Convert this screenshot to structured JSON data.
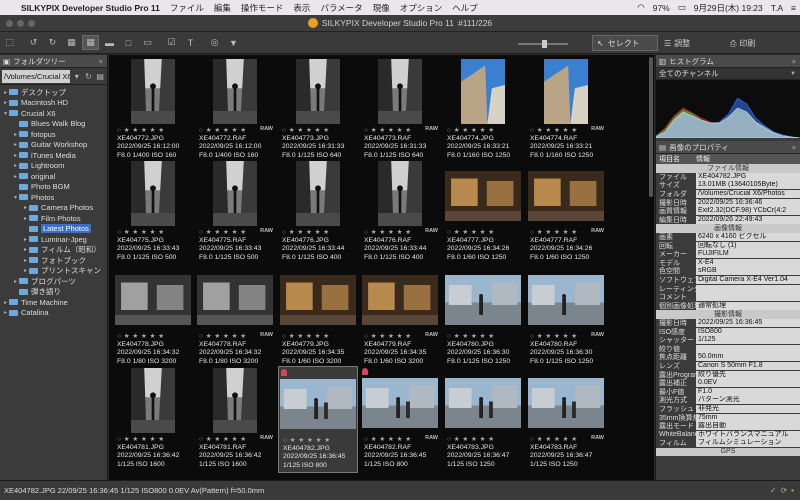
{
  "menubar": {
    "app_name": "SILKYPIX Developer Studio Pro 11",
    "menus": [
      "ファイル",
      "編集",
      "操作モード",
      "表示",
      "パラメータ",
      "現像",
      "オプション",
      "ヘルプ"
    ],
    "battery": "97%",
    "datetime": "9月29日(木) 19:23",
    "user": "T.A"
  },
  "titlebar": {
    "title": "SILKYPIX Developer Studio Pro 11",
    "counter": "#111/226"
  },
  "toolbar": {
    "mode_select": "セレクト",
    "adjust_label": "調整",
    "print_label": "印刷"
  },
  "folder_tree": {
    "header": "フォルダツリー",
    "path": "/Volumes/Crucial X6/",
    "items": [
      {
        "label": "デスクトップ",
        "level": 0,
        "arrow": "▸"
      },
      {
        "label": "Macintosh HD",
        "level": 0,
        "arrow": "▸"
      },
      {
        "label": "Crucial X6",
        "level": 0,
        "arrow": "▾"
      },
      {
        "label": "Blues Walk Blog",
        "level": 1,
        "arrow": ""
      },
      {
        "label": "fotopus",
        "level": 1,
        "arrow": "▸"
      },
      {
        "label": "Guitar Workshop",
        "level": 1,
        "arrow": "▸"
      },
      {
        "label": "iTunes Media",
        "level": 1,
        "arrow": "▸"
      },
      {
        "label": "Lightroom",
        "level": 1,
        "arrow": "▸"
      },
      {
        "label": "original",
        "level": 1,
        "arrow": "▸"
      },
      {
        "label": "Photo BGM",
        "level": 1,
        "arrow": ""
      },
      {
        "label": "Photos",
        "level": 1,
        "arrow": "▾"
      },
      {
        "label": "Camera Photos",
        "level": 2,
        "arrow": "▸"
      },
      {
        "label": "Film Photos",
        "level": 2,
        "arrow": "▸"
      },
      {
        "label": "Latest Photos",
        "level": 2,
        "arrow": "",
        "selected": true
      },
      {
        "label": "Luminar-Jpeg",
        "level": 2,
        "arrow": "▸"
      },
      {
        "label": "フィルム（昭和）",
        "level": 2,
        "arrow": "▸"
      },
      {
        "label": "フォトブック",
        "level": 2,
        "arrow": "▸"
      },
      {
        "label": "プリントスキャン",
        "level": 2,
        "arrow": "▸"
      },
      {
        "label": "ブログパーツ",
        "level": 1,
        "arrow": "▸"
      },
      {
        "label": "弾き語り",
        "level": 1,
        "arrow": ""
      },
      {
        "label": "Time Machine",
        "level": 0,
        "arrow": "▸"
      },
      {
        "label": "Catalina",
        "level": 0,
        "arrow": "▸"
      }
    ]
  },
  "thumbnails": [
    {
      "name": "XE404772.JPG",
      "date": "2022/09/25 16:12:00",
      "exif": "F8.0 1/400 ISO 160",
      "raw": false,
      "img": "bwstreet"
    },
    {
      "name": "XE404772.RAF",
      "date": "2022/09/25 16:12:00",
      "exif": "F8.0 1/400 ISO 160",
      "raw": true,
      "img": "bwstreet"
    },
    {
      "name": "XE404773.JPG",
      "date": "2022/09/25 16:31:33",
      "exif": "F8.0 1/125 ISO 640",
      "raw": false,
      "img": "bwalley"
    },
    {
      "name": "XE404773.RAF",
      "date": "2022/09/25 16:31:33",
      "exif": "F8.0 1/125 ISO 640",
      "raw": true,
      "img": "bwalley"
    },
    {
      "name": "XE404774.JPG",
      "date": "2022/09/25 16:33:21",
      "exif": "F8.0 1/160 ISO 1250",
      "raw": false,
      "img": "sky"
    },
    {
      "name": "XE404774.RAF",
      "date": "2022/09/25 16:33:21",
      "exif": "F8.0 1/160 ISO 1250",
      "raw": true,
      "img": "sky"
    },
    {
      "name": "XE404775.JPG",
      "date": "2022/09/25 16:33:43",
      "exif": "F8.0 1/125 ISO 500",
      "raw": false,
      "img": "bwperson"
    },
    {
      "name": "XE404775.RAF",
      "date": "2022/09/25 16:33:43",
      "exif": "F8.0 1/125 ISO 500",
      "raw": true,
      "img": "bwperson"
    },
    {
      "name": "XE404776.JPG",
      "date": "2022/09/25 16:33:44",
      "exif": "F8.0 1/125 ISO 400",
      "raw": false,
      "img": "bwperson2"
    },
    {
      "name": "XE404776.RAF",
      "date": "2022/09/25 16:33:44",
      "exif": "F8.0 1/125 ISO 400",
      "raw": true,
      "img": "bwperson2"
    },
    {
      "name": "XE404777.JPG",
      "date": "2022/09/25 16:34:26",
      "exif": "F8.0 1/60 ISO 1250",
      "raw": false,
      "img": "shop"
    },
    {
      "name": "XE404777.RAF",
      "date": "2022/09/25 16:34:26",
      "exif": "F8.0 1/60 ISO 1250",
      "raw": true,
      "img": "shop"
    },
    {
      "name": "XE404778.JPG",
      "date": "2022/09/25 16:34:32",
      "exif": "F8.0 1/80 ISO 3200",
      "raw": false,
      "img": "bwshop"
    },
    {
      "name": "XE404778.RAF",
      "date": "2022/09/25 16:34:32",
      "exif": "F8.0 1/80 ISO 3200",
      "raw": true,
      "img": "bwshop"
    },
    {
      "name": "XE404779.JPG",
      "date": "2022/09/25 16:34:35",
      "exif": "F8.0 1/60 ISO 3200",
      "raw": false,
      "img": "shop2"
    },
    {
      "name": "XE404779.RAF",
      "date": "2022/09/25 16:34:35",
      "exif": "F8.0 1/60 ISO 3200",
      "raw": true,
      "img": "shop2"
    },
    {
      "name": "XE404780.JPG",
      "date": "2022/09/25 16:36:30",
      "exif": "F8.0 1/125 ISO 1250",
      "raw": false,
      "img": "cyclist"
    },
    {
      "name": "XE404780.RAF",
      "date": "2022/09/25 16:36:30",
      "exif": "F8.0 1/125 ISO 1250",
      "raw": true,
      "img": "cyclist"
    },
    {
      "name": "XE404781.JPG",
      "date": "2022/09/25 16:36:42",
      "exif": "1/125 ISO 1600",
      "raw": false,
      "img": "bwbuilding"
    },
    {
      "name": "XE404781.RAF",
      "date": "2022/09/25 16:36:42",
      "exif": "1/125 ISO 1600",
      "raw": true,
      "img": "bwbuilding"
    },
    {
      "name": "XE404782.JPG",
      "date": "2022/09/25 16:36:45",
      "exif": "1/125 ISO 800",
      "raw": false,
      "img": "couple",
      "selected": true,
      "tag": true
    },
    {
      "name": "XE404782.RAF",
      "date": "2022/09/25 16:36:45",
      "exif": "1/125 ISO 800",
      "raw": true,
      "img": "couple",
      "tag": true
    },
    {
      "name": "XE404783.JPG",
      "date": "2022/09/25 16:36:47",
      "exif": "1/125 ISO 1250",
      "raw": false,
      "img": "walkers"
    },
    {
      "name": "XE404783.RAF",
      "date": "2022/09/25 16:36:47",
      "exif": "1/125 ISO 1250",
      "raw": true,
      "img": "walkers"
    }
  ],
  "histogram": {
    "header": "ヒストグラム",
    "channel": "全てのチャンネル"
  },
  "properties": {
    "header": "画像のプロパティ",
    "col_item": "項目名",
    "col_info": "情報",
    "rows": [
      {
        "section": "ファイル情報"
      },
      {
        "k": "ファイル",
        "v": "XE404782.JPG"
      },
      {
        "k": "サイズ",
        "v": "13.01MB (13640105Byte)"
      },
      {
        "k": "フォルダ",
        "v": "/Volumes/Crucial X6/Photos"
      },
      {
        "k": "撮影日時",
        "v": "2022/09/25 16:36:46"
      },
      {
        "k": "画質情報",
        "v": "Exif2.32(DCF.98) YCbCr(4:2"
      },
      {
        "k": "編集日時",
        "v": "2022/09/26 22:49:43"
      },
      {
        "section": "画像情報"
      },
      {
        "k": "画素",
        "v": "6240 x 4160 ピクセル"
      },
      {
        "k": "回転",
        "v": "回転なし (1)"
      },
      {
        "k": "メーカー",
        "v": "FUJIFILM"
      },
      {
        "k": "モデル",
        "v": "X-E4"
      },
      {
        "k": "色空間",
        "v": "sRGB"
      },
      {
        "k": "ソフトウェア",
        "v": "Digital Camera X-E4 Ver1.04"
      },
      {
        "k": "レーティング",
        "v": ""
      },
      {
        "k": "コメント",
        "v": ""
      },
      {
        "k": "個別画像処理",
        "v": "通常処理"
      },
      {
        "section": "撮影情報"
      },
      {
        "k": "撮影日時",
        "v": "2022/09/25 16:36:45"
      },
      {
        "k": "ISO感度",
        "v": "ISO800"
      },
      {
        "k": "シャッター",
        "v": "1/125"
      },
      {
        "k": "絞り値",
        "v": ""
      },
      {
        "k": "焦点距離",
        "v": "50.0mm"
      },
      {
        "k": "レンズ",
        "v": "Canon S 50mm F1.8"
      },
      {
        "k": "露出Program",
        "v": "絞り優先"
      },
      {
        "k": "露出補正",
        "v": "0.0EV"
      },
      {
        "k": "最小F値",
        "v": "F1.0"
      },
      {
        "k": "測光方式",
        "v": "パターン測光"
      },
      {
        "k": "フラッシュ",
        "v": "非発光"
      },
      {
        "k": "35mm換算焦点",
        "v": "75mm"
      },
      {
        "k": "露出モード",
        "v": "露出自動"
      },
      {
        "k": "WhiteBalance",
        "v": "ホワイトバランスマニュアル"
      },
      {
        "k": "フィルム",
        "v": "フィルムシミュレーション"
      },
      {
        "section": "GPS"
      }
    ]
  },
  "statusbar": {
    "text": "XE404782.JPG 22/09/25 16:36:45 1/125 ISO800 0.0EV Av(Pattern) f=50.0mm"
  }
}
